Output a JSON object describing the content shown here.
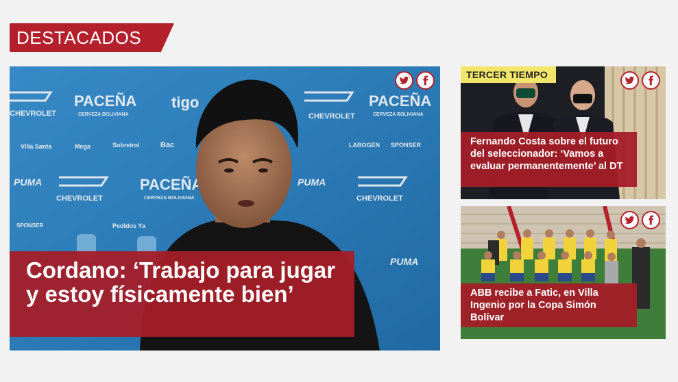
{
  "section": {
    "label": "DESTACADOS"
  },
  "main_story": {
    "headline": "Cordano: ‘Trabajo para jugar y estoy físicamente bien’",
    "share": {
      "twitter_icon": "twitter-icon",
      "facebook_icon": "facebook-icon"
    },
    "backdrop_text": [
      "PACEÑA",
      "CERVEZA BOLIVIANA",
      "CHEVROLET",
      "tigo",
      "PUMA",
      "Villa Santa",
      "Mega",
      "Sobreirol",
      "LABOGEN",
      "SPONSER",
      "Pedidos Ya",
      "Bac"
    ]
  },
  "side_stories": [
    {
      "tag": "TERCER TIEMPO",
      "headline": "Fernando Costa sobre el futuro del seleccionador: ‘Vamos a evaluar permanentemente’ al DT"
    },
    {
      "tag": "",
      "headline": "ABB recibe a Fatic, en Villa Ingenio por la Copa Simón Bolívar"
    }
  ],
  "colors": {
    "brand_red": "#b4202c",
    "tag_yellow": "#f1e56a",
    "page_bg": "#f2f2f2"
  }
}
